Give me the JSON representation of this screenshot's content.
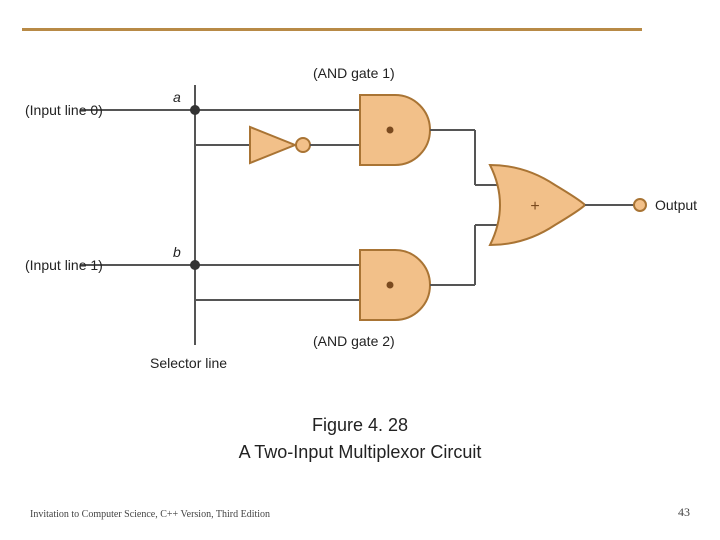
{
  "labels": {
    "input0": "(Input line 0)",
    "input1": "(Input line 1)",
    "a": "a",
    "b": "b",
    "and1": "(AND gate 1)",
    "and2": "(AND gate 2)",
    "selector": "Selector line",
    "orSym": "+",
    "output": "Output"
  },
  "caption": {
    "fig": "Figure 4. 28",
    "title": "A Two-Input Multiplexor Circuit"
  },
  "footer": {
    "left": "Invitation to Computer Science, C++ Version, Third Edition",
    "page": "43"
  },
  "chart_data": {
    "type": "table",
    "title": "Two-Input Multiplexor Circuit (Figure 4.28)",
    "components": [
      {
        "id": "input0",
        "type": "input",
        "label": "Input line 0 (a)"
      },
      {
        "id": "input1",
        "type": "input",
        "label": "Input line 1 (b)"
      },
      {
        "id": "selector",
        "type": "input",
        "label": "Selector line"
      },
      {
        "id": "not",
        "type": "NOT gate"
      },
      {
        "id": "and1",
        "type": "AND gate",
        "label": "AND gate 1"
      },
      {
        "id": "and2",
        "type": "AND gate",
        "label": "AND gate 2"
      },
      {
        "id": "or",
        "type": "OR gate"
      },
      {
        "id": "output",
        "type": "output",
        "label": "Output"
      }
    ],
    "connections": [
      {
        "from": "input0",
        "to": "and1",
        "label": "a"
      },
      {
        "from": "selector",
        "to": "not"
      },
      {
        "from": "not",
        "to": "and1"
      },
      {
        "from": "input1",
        "to": "and2",
        "label": "b"
      },
      {
        "from": "selector",
        "to": "and2"
      },
      {
        "from": "and1",
        "to": "or"
      },
      {
        "from": "and2",
        "to": "or"
      },
      {
        "from": "or",
        "to": "output"
      }
    ]
  }
}
